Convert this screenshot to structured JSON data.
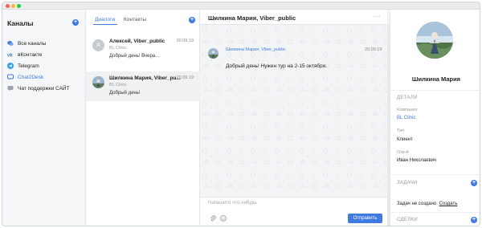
{
  "sidebar": {
    "title": "Каналы",
    "items": [
      {
        "label": "Все каналы",
        "icon": "chat-bubbles-icon"
      },
      {
        "label": "вКонтакте",
        "icon": "vk-icon"
      },
      {
        "label": "Telegram",
        "icon": "telegram-icon"
      },
      {
        "label": "Chat2Desk",
        "icon": "chat2desk-icon"
      },
      {
        "label": "Чат поддержки САЙТ",
        "icon": "chat-bubble-icon"
      }
    ]
  },
  "dialogs": {
    "tabs": [
      {
        "label": "Диалоги"
      },
      {
        "label": "Контакты"
      }
    ],
    "list": [
      {
        "initial": "А",
        "name": "Алексей, Viber_public",
        "date": "20.09.19",
        "org": "BL Clinic",
        "message": "Добрый день! Вчера..."
      },
      {
        "name": "Шилкина Мария, Viber_pu...",
        "date": "20.09.19",
        "org": "BL Clinic",
        "message": "Добрый день!"
      }
    ]
  },
  "chat": {
    "title": "Шилкина Мария, Viber_public",
    "menu": "···",
    "message": {
      "from": "Шилкина Мария, Viber_public",
      "date": "20.09.19",
      "text": "Добрый день! Нужен тур на 2-15 октября."
    },
    "composer": {
      "placeholder": "Напишите что-нибудь",
      "send_label": "Отправить"
    }
  },
  "details": {
    "name": "Шилкина Мария",
    "section_details": "ДЕТАЛИ",
    "fields": [
      {
        "label": "Компания",
        "value": "BL Clinic"
      },
      {
        "label": "Тип",
        "value": "Клиент"
      },
      {
        "label": "Отв-й",
        "value": "Иван Николаевич"
      }
    ],
    "section_tasks": "ЗАДАЧИ",
    "task_text": "Задач не создано.",
    "task_link": "Создать",
    "section_deals": "СДЕЛКИ"
  },
  "colors": {
    "accent": "#3f7ae0"
  }
}
